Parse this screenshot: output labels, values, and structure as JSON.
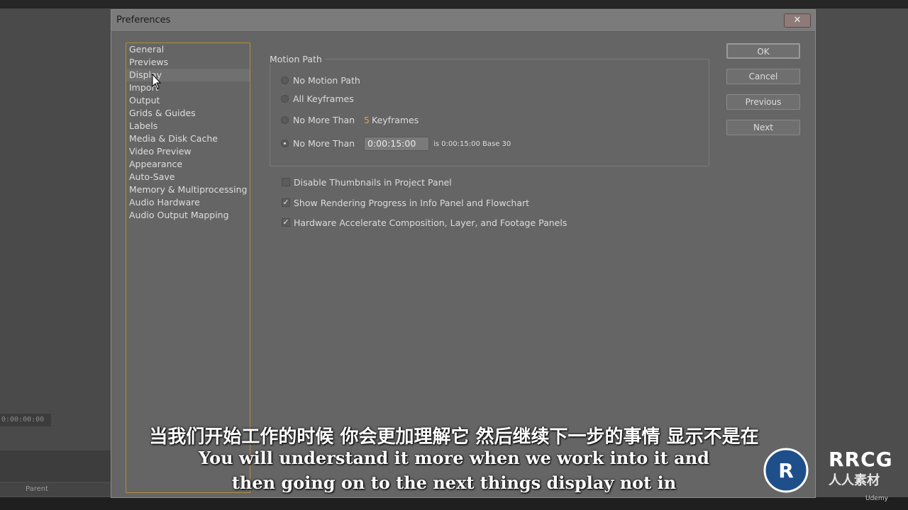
{
  "dialog": {
    "title": "Preferences",
    "close_symbol": "✕"
  },
  "categories": [
    {
      "label": "General"
    },
    {
      "label": "Previews"
    },
    {
      "label": "Display",
      "selected": true
    },
    {
      "label": "Import"
    },
    {
      "label": "Output"
    },
    {
      "label": "Grids & Guides"
    },
    {
      "label": "Labels"
    },
    {
      "label": "Media & Disk Cache"
    },
    {
      "label": "Video Preview"
    },
    {
      "label": "Appearance"
    },
    {
      "label": "Auto-Save"
    },
    {
      "label": "Memory & Multiprocessing"
    },
    {
      "label": "Audio Hardware"
    },
    {
      "label": "Audio Output Mapping"
    }
  ],
  "motion_path": {
    "title": "Motion Path",
    "options": [
      {
        "label": "No Motion Path",
        "checked": false
      },
      {
        "label": "All Keyframes",
        "checked": false
      },
      {
        "label": "No More Than",
        "value": "5",
        "suffix": "Keyframes",
        "checked": false
      },
      {
        "label": "No More Than",
        "value": "0:00:15:00",
        "note": "is 0:00:15:00  Base 30",
        "checked": true
      }
    ]
  },
  "checkboxes": [
    {
      "label": "Disable Thumbnails in Project Panel",
      "checked": false
    },
    {
      "label": "Show Rendering Progress in Info Panel and Flowchart",
      "checked": true
    },
    {
      "label": "Hardware Accelerate Composition, Layer, and Footage Panels",
      "checked": true
    }
  ],
  "buttons": {
    "ok": "OK",
    "cancel": "Cancel",
    "previous": "Previous",
    "next": "Next"
  },
  "background": {
    "timecode": "0:00:00:00",
    "parent_label": "Parent"
  },
  "subtitles": {
    "zh": "当我们开始工作的时候 你会更加理解它 然后继续下一步的事情 显示不是在",
    "en_line1": "You will understand it more when we work into it and",
    "en_line2": "then going on to the next things display not in"
  },
  "watermark": {
    "logo_text": "RRCG",
    "logo_sub": "人人素材",
    "udemy": "Udemy"
  },
  "colors": {
    "accent_orange": "#d6a640",
    "list_border": "#b08f3a"
  }
}
